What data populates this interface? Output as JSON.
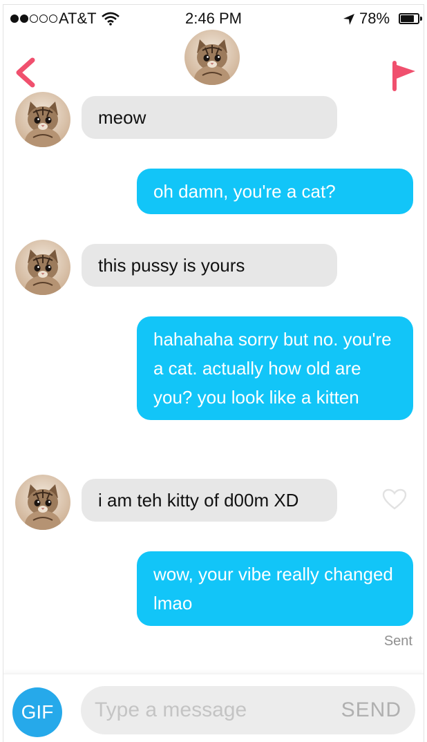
{
  "status_bar": {
    "carrier": "AT&T",
    "time": "2:46 PM",
    "battery": "78%",
    "battery_level": 0.78,
    "signal_bars_filled": 2,
    "signal_bars_total": 5,
    "icons": [
      "signal-dots-icon",
      "wifi-icon",
      "location-arrow-icon",
      "battery-icon"
    ]
  },
  "header": {
    "name": "",
    "icons": [
      "back-chevron-icon",
      "flag-icon"
    ],
    "accent_color": "#f0506e"
  },
  "messages": [
    {
      "direction": "incoming",
      "text": "meow"
    },
    {
      "direction": "outgoing",
      "text": "oh damn, you're a cat?"
    },
    {
      "direction": "incoming",
      "text": "this pussy is yours"
    },
    {
      "direction": "outgoing",
      "text": "hahahaha sorry but no. you're a cat. actually how old are you? you look like a kitten"
    },
    {
      "direction": "incoming",
      "text": "i am teh kitty of d00m XD"
    },
    {
      "direction": "outgoing",
      "text": "wow, your vibe really changed lmao"
    }
  ],
  "sent_label": "Sent",
  "composer": {
    "gif_label": "GIF",
    "placeholder": "Type a message",
    "send_label": "SEND"
  },
  "colors": {
    "outgoing_bubble": "#12c5f8",
    "incoming_bubble": "#e7e7e7",
    "gif_button": "#26a9ea"
  }
}
